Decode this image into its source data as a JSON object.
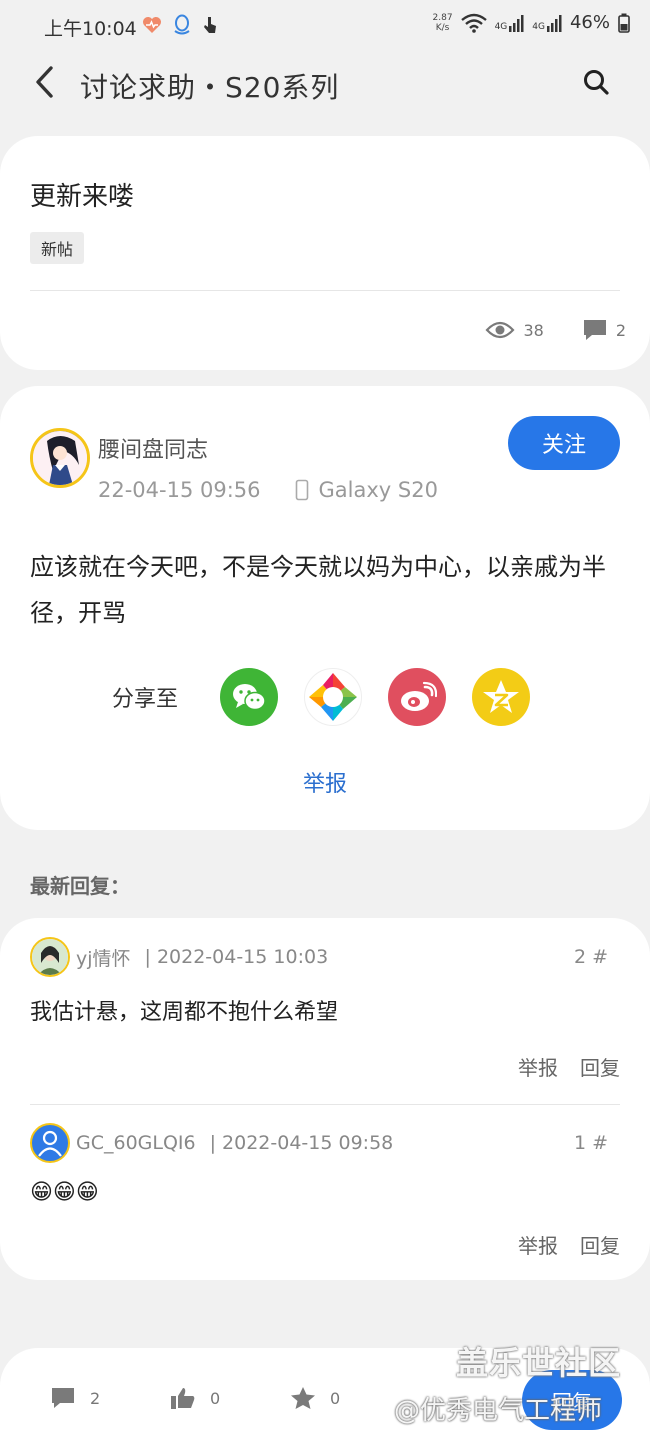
{
  "status_bar": {
    "time": "上午10:04",
    "net_speed_value": "2.87",
    "net_speed_unit": "K/s",
    "signal1": "4G",
    "signal2": "4G",
    "battery": "46%"
  },
  "app_bar": {
    "title": "讨论求助・S20系列"
  },
  "thread": {
    "title": "更新来喽",
    "tag": "新帖",
    "views": "38",
    "comments": "2"
  },
  "post": {
    "author": "腰间盘同志",
    "date": "22-04-15 09:56",
    "device": "Galaxy S20",
    "follow_label": "关注",
    "body": "应该就在今天吧，不是今天就以妈为中心，以亲戚为半径，开骂",
    "share_label": "分享至",
    "share_icons": [
      "wechat-icon",
      "moments-icon",
      "weibo-icon",
      "qzone-icon"
    ],
    "report_label": "举报"
  },
  "replies_section": {
    "label": "最新回复："
  },
  "replies": [
    {
      "name": "yj情怀",
      "separator": "|",
      "time": "2022-04-15 10:03",
      "floor": "2 #",
      "body": "我估计悬，这周都不抱什么希望",
      "report_label": "举报",
      "reply_label": "回复"
    },
    {
      "name": "GC_60GLQI6",
      "separator": "|",
      "time": "2022-04-15 09:58",
      "floor": "1 #",
      "body": "😁😁😁",
      "report_label": "举报",
      "reply_label": "回复"
    }
  ],
  "bottom_bar": {
    "comments": "2",
    "likes": "0",
    "favorites": "0",
    "fab_label": "回复"
  },
  "watermark": {
    "line1": "盖乐世社区",
    "line2": "@优秀电气工程师"
  },
  "colors": {
    "accent": "#2777e8",
    "link": "#2b6fcf",
    "avatar_ring": "#f5c518"
  }
}
